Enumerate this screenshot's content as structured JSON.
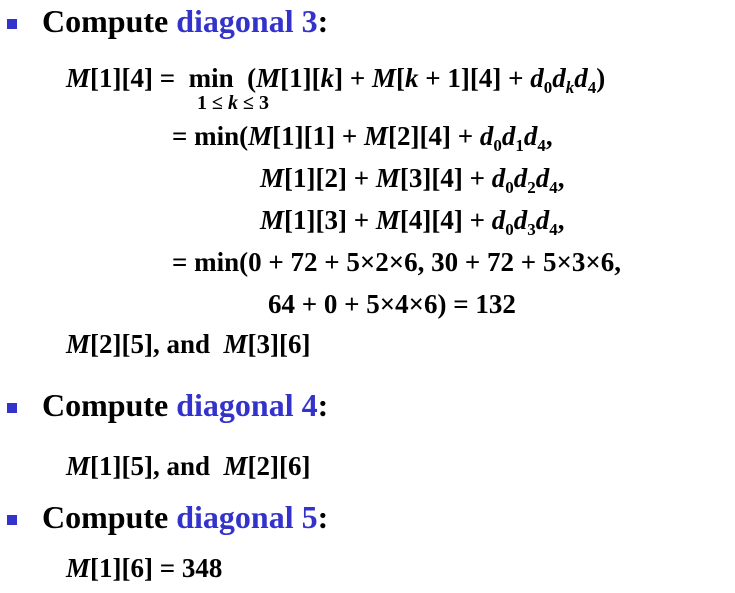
{
  "sections": [
    {
      "heading_prefix": "Compute",
      "heading_accent": "diagonal 3",
      "heading_suffix": ":",
      "lines": [
        "M[1][4] = min (M[1][k] + M[k+1][4] + d0dkd4)",
        "1 ≤ k ≤ 3",
        "= min(M[1][1] + M[2][4] + d0d1d4,",
        "M[1][2] + M[3][4] + d0d2d4,",
        "M[1][3] + M[4][4] + d0d3d4,",
        "= min(0 + 72 + 5×2×6,  30 + 72 + 5×3×6,",
        "64 + 0 + 5×4×6) = 132",
        "M[2][5], and M[3][6]"
      ]
    },
    {
      "heading_prefix": "Compute",
      "heading_accent": "diagonal 4",
      "heading_suffix": ":",
      "lines": [
        "M[1][5], and M[2][6]"
      ]
    },
    {
      "heading_prefix": "Compute",
      "heading_accent": "diagonal 5",
      "heading_suffix": ":",
      "lines": [
        "M[1][6] = 348"
      ]
    }
  ],
  "colors": {
    "accent": "#3333cc",
    "text": "#000000"
  }
}
